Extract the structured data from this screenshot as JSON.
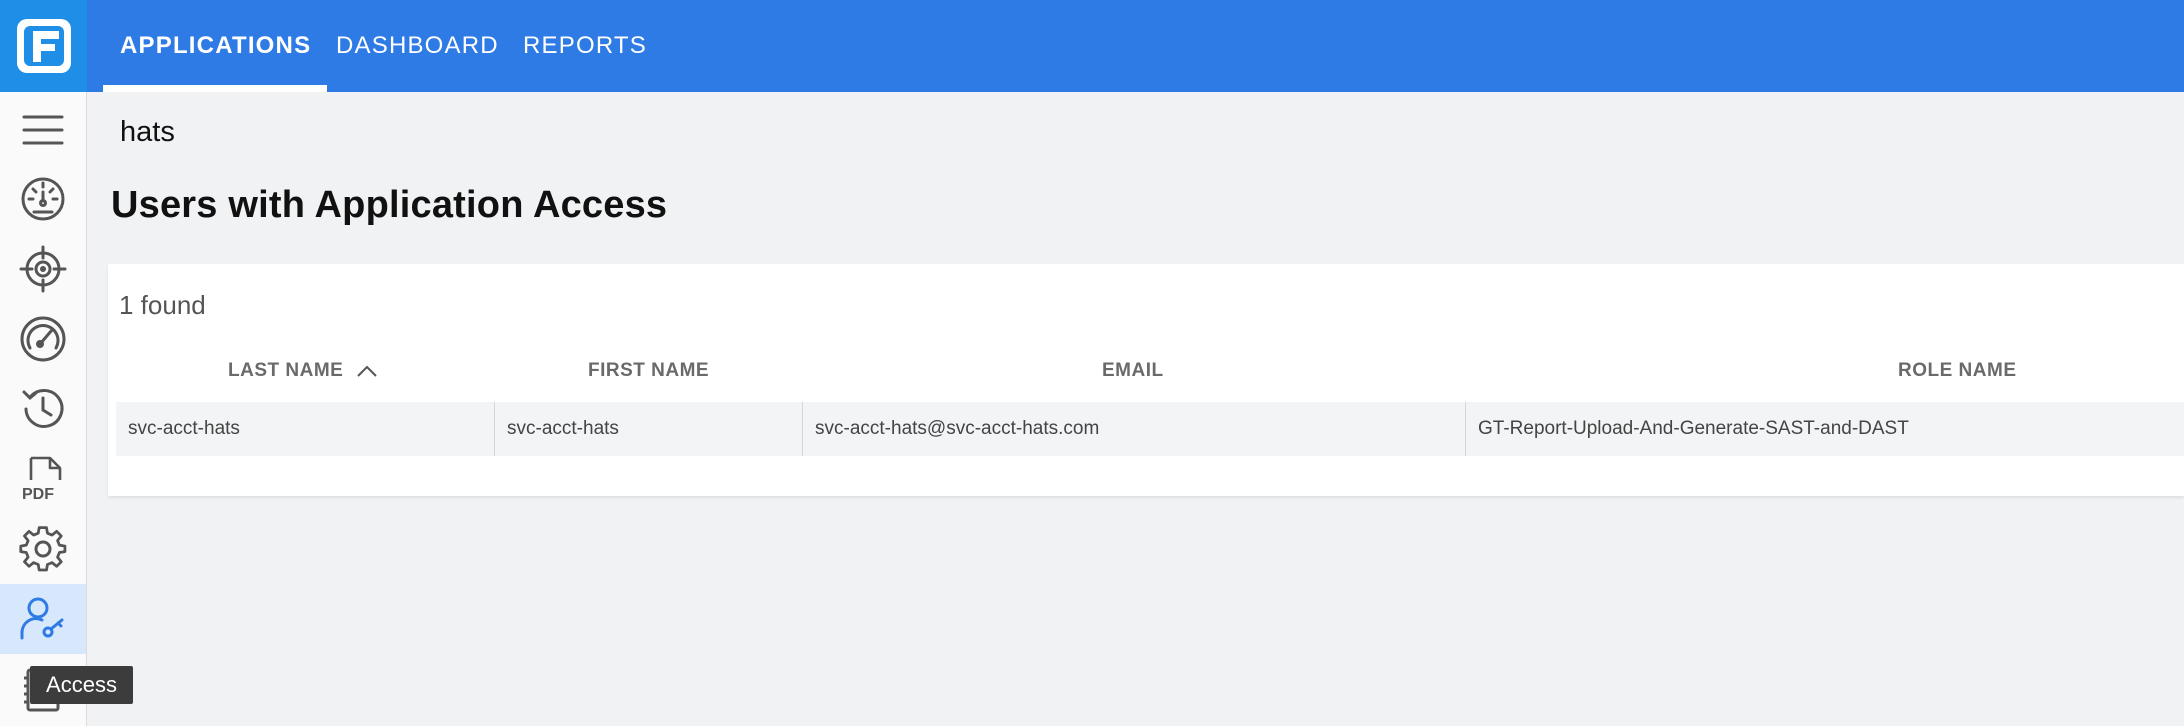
{
  "nav": {
    "tabs": [
      {
        "label": "APPLICATIONS",
        "active": true
      },
      {
        "label": "DASHBOARD",
        "active": false
      },
      {
        "label": "REPORTS",
        "active": false
      }
    ]
  },
  "sidebar": {
    "icons": [
      "menu-icon",
      "dashboard-gauge-icon",
      "target-icon",
      "speedometer-icon",
      "history-icon",
      "pdf-icon",
      "gear-icon",
      "user-key-icon",
      "notebook-icon"
    ],
    "active": "user-key-icon"
  },
  "tooltip": {
    "text": "Access"
  },
  "page": {
    "app_name": "hats",
    "title": "Users with Application Access"
  },
  "table": {
    "found_label": "1 found",
    "columns": [
      "LAST NAME",
      "FIRST NAME",
      "EMAIL",
      "ROLE NAME"
    ],
    "sorted_column": "LAST NAME",
    "rows": [
      [
        "svc-acct-hats",
        "svc-acct-hats",
        "svc-acct-hats@svc-acct-hats.com",
        "GT-Report-Upload-And-Generate-SAST-and-DAST"
      ]
    ]
  },
  "colors": {
    "topbar": "#2f7be6",
    "logo_bg": "#1f8ee6",
    "active_sidebar": "#d7e8fc",
    "icon_active": "#2f7be6",
    "icon": "#555555"
  }
}
